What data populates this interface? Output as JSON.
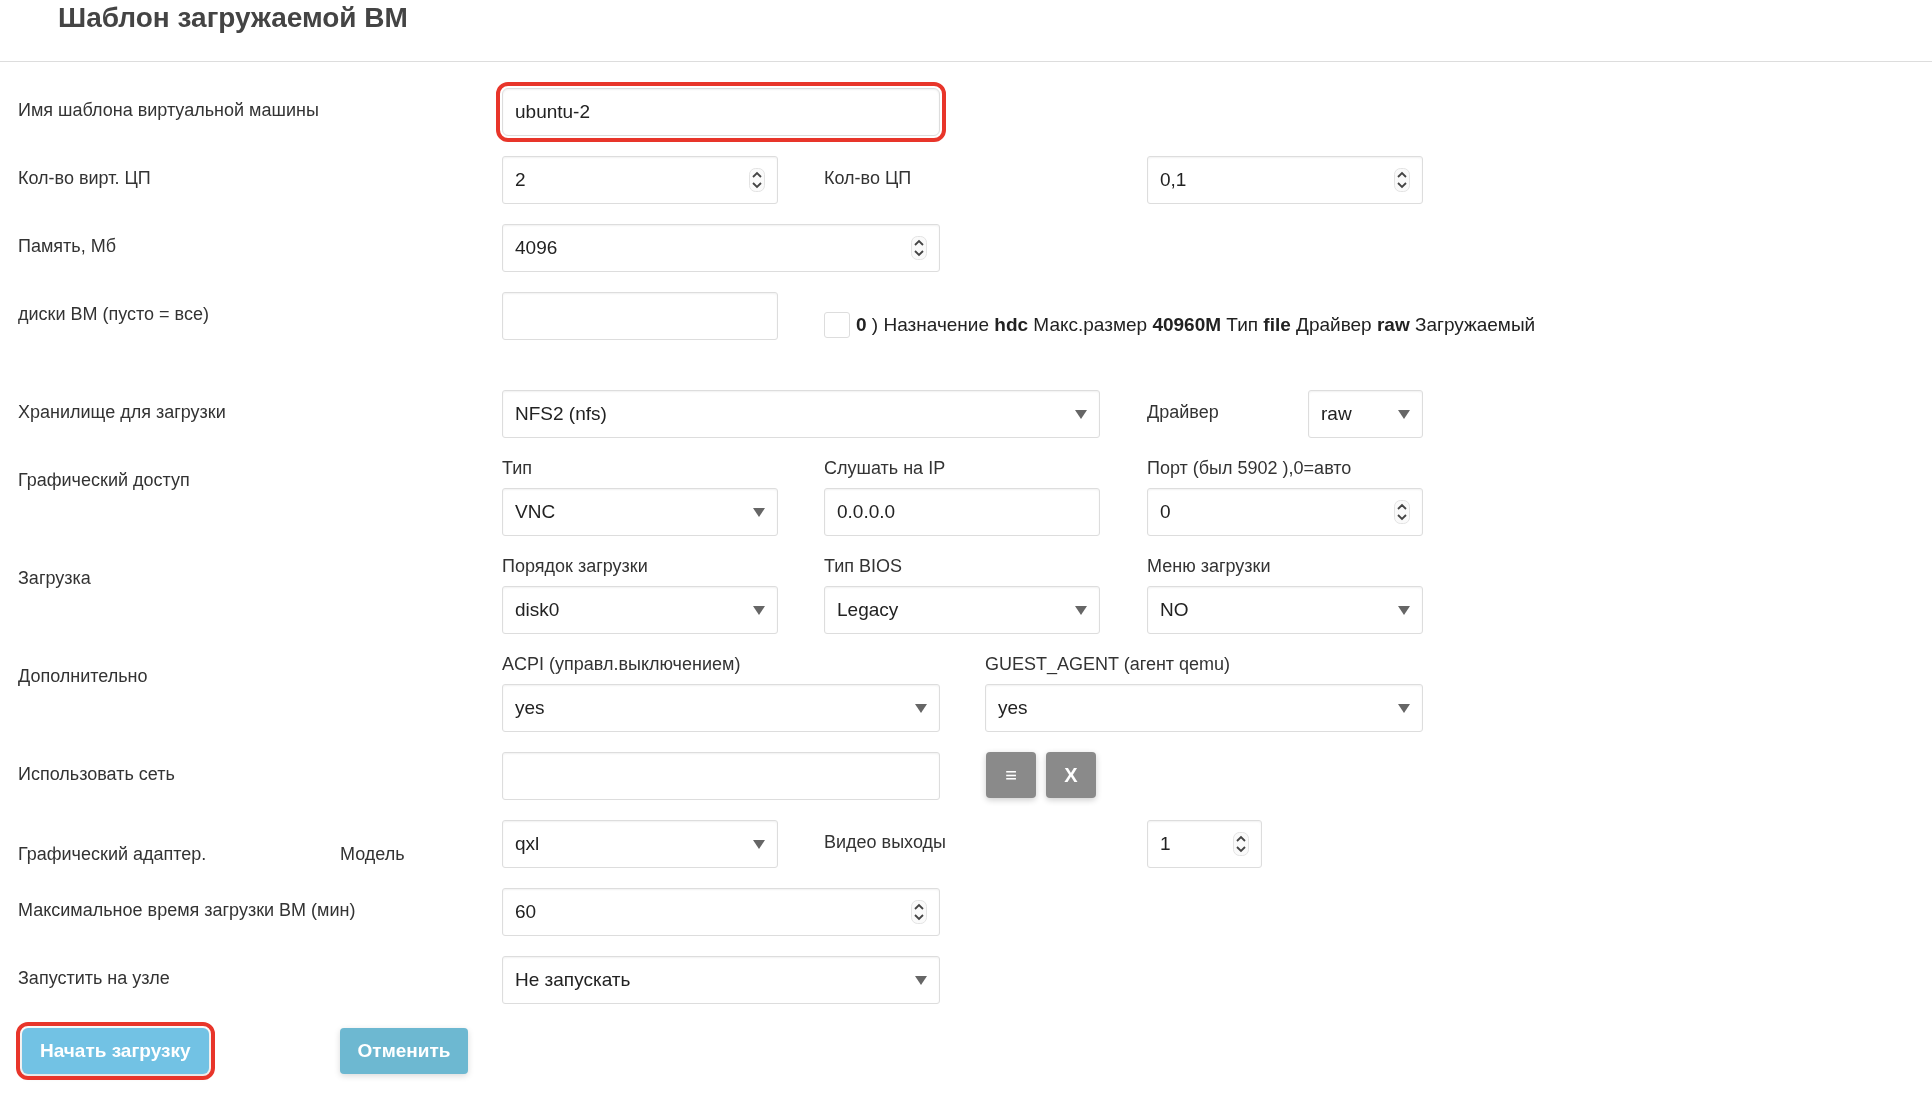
{
  "title": "Шаблон загружаемой ВМ",
  "rows": [
    {
      "kind": "name",
      "label": "Имя шаблона виртуальной машины",
      "field": {
        "value": "ubuntu-2",
        "highlighted": true
      }
    },
    {
      "kind": "cpu",
      "label": "Кол-во вирт. ЦП",
      "vcpu": {
        "value": "2"
      },
      "cpu_label": "Кол-во ЦП",
      "cpu": {
        "value": "0,1"
      }
    },
    {
      "kind": "memory",
      "label": "Память, Мб",
      "field": {
        "value": "4096"
      }
    },
    {
      "kind": "disks",
      "label": "диски ВМ (пусто = все)",
      "disk": {
        "checked": false,
        "text": "**0** ) Назначение **hdc** Макс.размер **40960M** Тип **file** Драйвер **raw** Загружаемый"
      }
    },
    {
      "kind": "storage",
      "label": "Хранилище для загрузки",
      "storage": {
        "value": "NFS2 (nfs)"
      },
      "driver_label": "Драйвер",
      "driver": {
        "value": "raw"
      }
    },
    {
      "kind": "triple",
      "label": "Графический доступ",
      "controls": [
        {
          "kind": "select",
          "caption": "Тип",
          "value": "VNC"
        },
        {
          "kind": "text",
          "caption": "Слушать на IP",
          "value": "0.0.0.0"
        },
        {
          "kind": "spinner",
          "caption": "Порт (был 5902 ),0=авто",
          "value": "0"
        }
      ]
    },
    {
      "kind": "triple",
      "label": "Загрузка",
      "controls": [
        {
          "kind": "select",
          "caption": "Порядок загрузки",
          "value": "disk0"
        },
        {
          "kind": "select",
          "caption": "Тип BIOS",
          "value": "Legacy"
        },
        {
          "kind": "select",
          "caption": "Меню загрузки",
          "value": "NO"
        }
      ]
    },
    {
      "kind": "pair",
      "label": "Дополнительно",
      "controls": [
        {
          "kind": "select",
          "caption": "ACPI (управл.выключением)",
          "value": "yes"
        },
        {
          "kind": "select",
          "caption": "GUEST_AGENT (агент qemu)",
          "value": "yes"
        }
      ]
    },
    {
      "kind": "network",
      "label": "Использовать сеть",
      "buttons": [
        "≡",
        "X"
      ]
    },
    {
      "kind": "adapter",
      "label": "Графический адаптер.",
      "model_label": "Модель",
      "model": {
        "value": "qxl"
      },
      "outputs_label": "Видео выходы",
      "outputs": {
        "value": "1"
      }
    },
    {
      "kind": "wide_spinner",
      "label": "Максимальное время загрузки ВМ (мин)",
      "field": {
        "value": "60"
      }
    },
    {
      "kind": "wide_select",
      "label": "Запустить на узле",
      "field": {
        "value": "Не запускать"
      }
    }
  ],
  "actions": [
    {
      "kind": "primary",
      "label": "Начать загрузку",
      "highlighted": true
    },
    {
      "kind": "secondary",
      "label": "Отменить",
      "highlighted": false
    }
  ]
}
